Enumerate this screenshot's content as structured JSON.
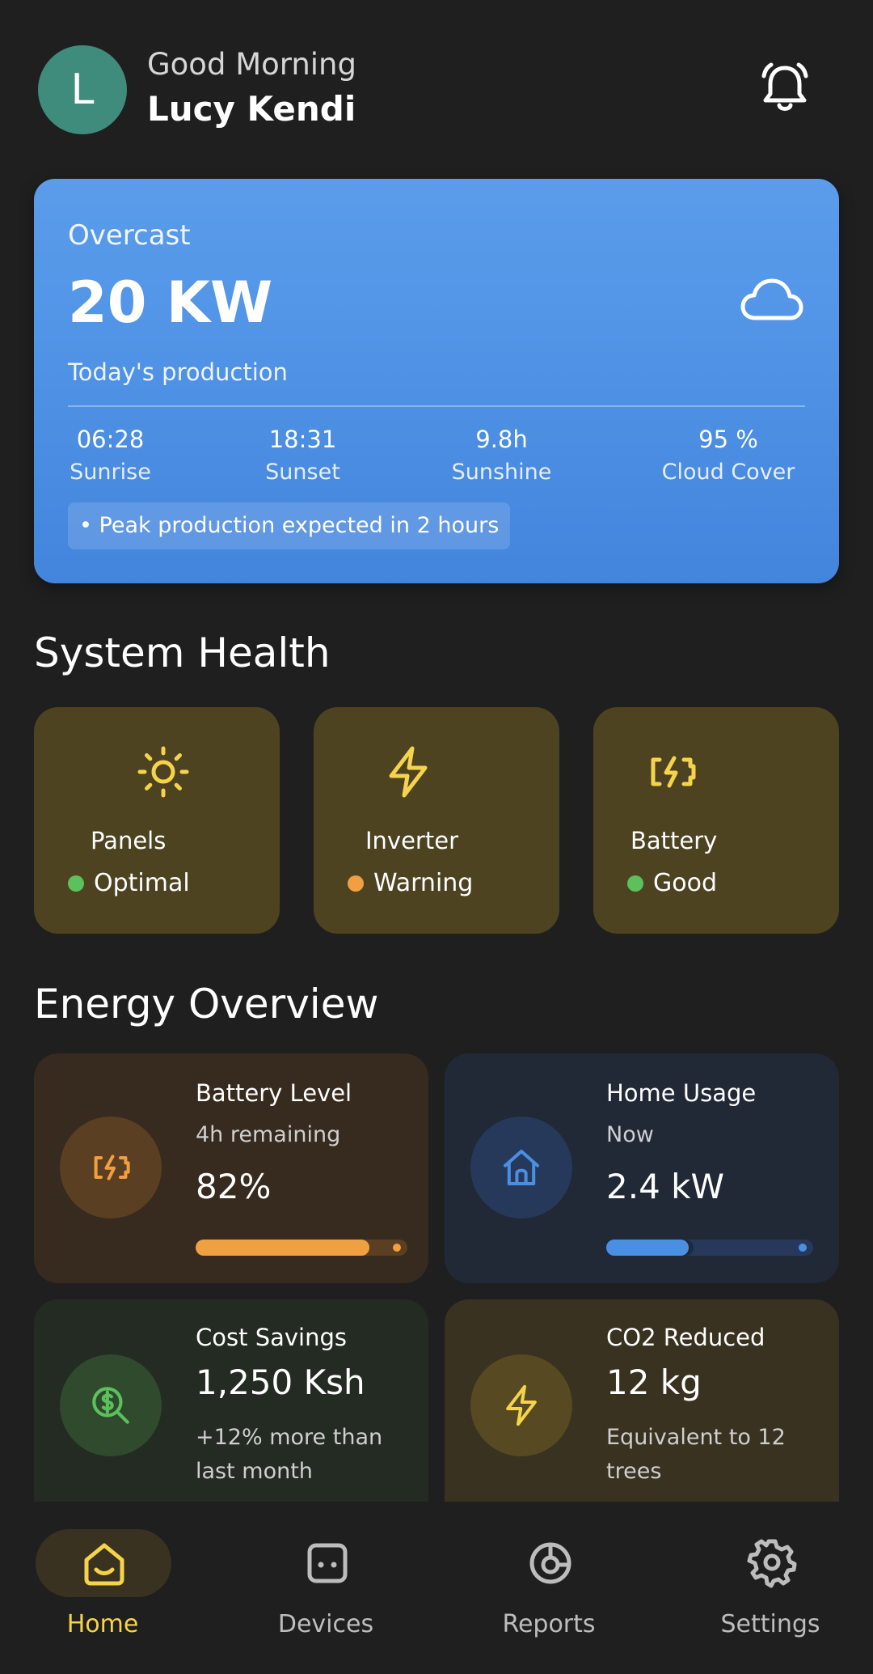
{
  "header": {
    "avatar_initial": "L",
    "greeting": "Good Morning",
    "user_name": "Lucy Kendi",
    "bell_icon": "notification-bell-icon"
  },
  "weather": {
    "condition": "Overcast",
    "production_value": "20 KW",
    "production_label": "Today's production",
    "icon": "cloud-icon",
    "stats": [
      {
        "value": "06:28",
        "label": "Sunrise"
      },
      {
        "value": "18:31",
        "label": "Sunset"
      },
      {
        "value": "9.8h",
        "label": "Sunshine"
      },
      {
        "value": "95 %",
        "label": "Cloud Cover"
      }
    ],
    "note": "• Peak production expected in 2 hours"
  },
  "system_health": {
    "title": "System Health",
    "items": [
      {
        "label": "Panels",
        "status": "Optimal",
        "status_color": "#5cc15c",
        "icon": "sun-icon"
      },
      {
        "label": "Inverter",
        "status": "Warning",
        "status_color": "#f0a040",
        "icon": "lightning-icon"
      },
      {
        "label": "Battery",
        "status": "Good",
        "status_color": "#5cc15c",
        "icon": "battery-charging-icon"
      }
    ]
  },
  "energy_overview": {
    "title": "Energy Overview",
    "battery": {
      "title": "Battery Level",
      "subtitle": "4h remaining",
      "value": "82%",
      "level": 0.82,
      "icon": "battery-charging-icon"
    },
    "home_usage": {
      "title": "Home Usage",
      "subtitle": "Now",
      "value": "2.4 kW",
      "level": 0.4,
      "icon": "home-icon"
    },
    "cost_savings": {
      "title": "Cost Savings",
      "value": "1,250 Ksh",
      "note": "+12% more than last month",
      "icon": "money-search-icon"
    },
    "co2": {
      "title": "CO2 Reduced",
      "value": "12 kg",
      "note": "Equivalent to 12 trees",
      "icon": "lightning-icon"
    }
  },
  "nav": {
    "items": [
      {
        "label": "Home",
        "active": true,
        "icon": "home-icon"
      },
      {
        "label": "Devices",
        "active": false,
        "icon": "devices-icon"
      },
      {
        "label": "Reports",
        "active": false,
        "icon": "reports-icon"
      },
      {
        "label": "Settings",
        "active": false,
        "icon": "gear-icon"
      }
    ]
  },
  "colors": {
    "background": "#1f1f1f",
    "accent_yellow": "#f5d34a",
    "accent_orange": "#f0a040",
    "accent_blue": "#4a90e2"
  }
}
